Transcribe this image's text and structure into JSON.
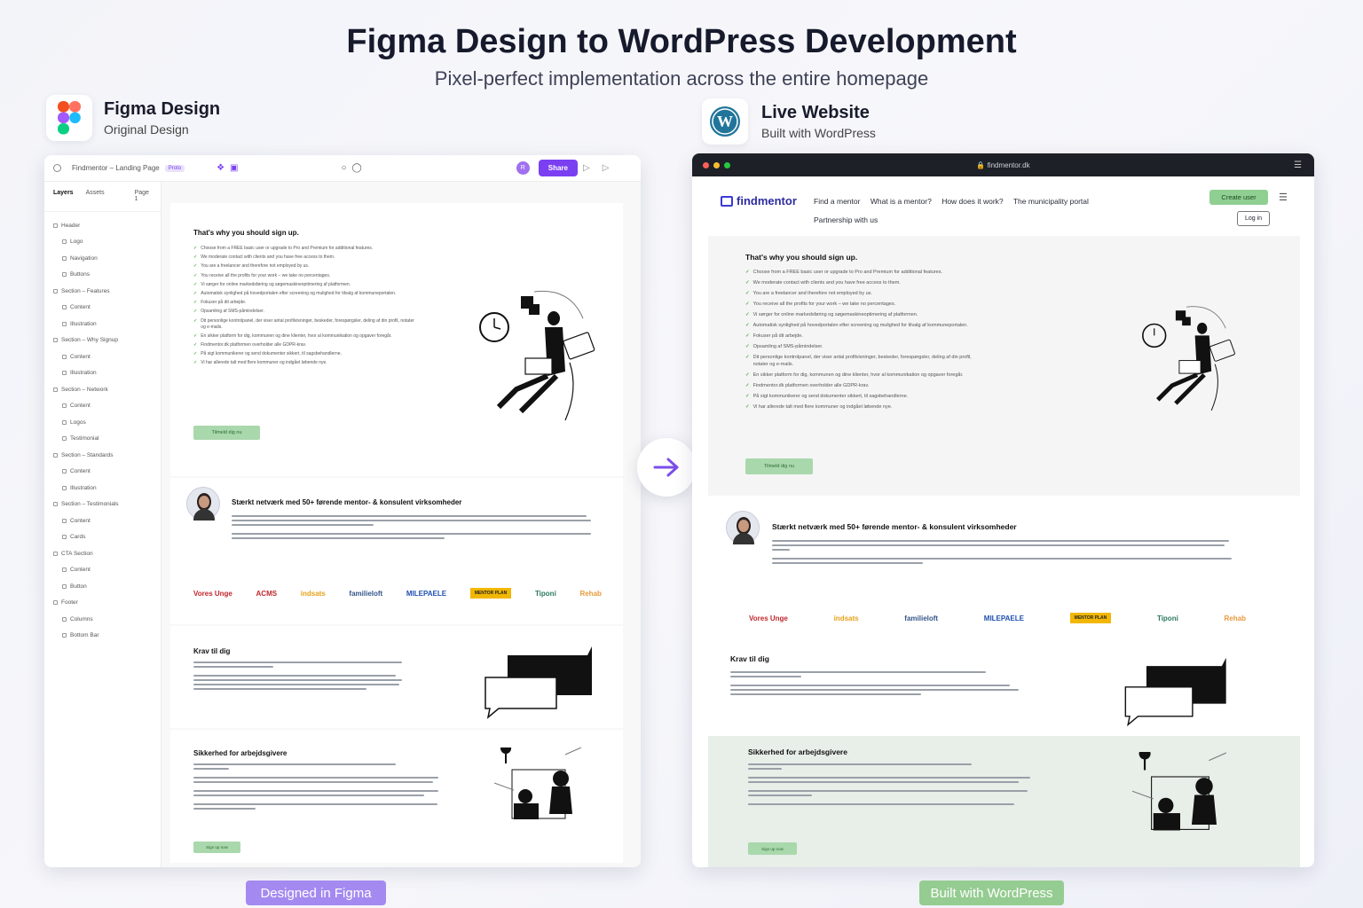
{
  "header": {
    "title": "Figma Design to WordPress Development",
    "subtitle": "Pixel-perfect implementation across the entire homepage"
  },
  "left_header": {
    "title": "Figma Design",
    "subtitle": "Original Design"
  },
  "right_header": {
    "title": "Live Website",
    "subtitle": "Built with WordPress"
  },
  "figma": {
    "file_name": "Findmentor – Landing Page",
    "badge": "Proto",
    "share": "Share",
    "avatar": "R",
    "tabs": [
      "Layers",
      "Assets",
      "Page 1"
    ],
    "layers": [
      "Header",
      "Logo",
      "Navigation",
      "Buttons",
      "Section – Features",
      "Content",
      "Illustration",
      "Section – Why Signup",
      "Content",
      "Illustration",
      "Section – Network",
      "Content",
      "Logos",
      "Testimonial",
      "Section – Standards",
      "Content",
      "Illustration",
      "Section – Testimonials",
      "Content",
      "Cards",
      "CTA Section",
      "Content",
      "Button",
      "Footer",
      "Columns",
      "Bottom Bar"
    ]
  },
  "browser": {
    "url": "findmentor.dk"
  },
  "site": {
    "logo": "findmentor",
    "nav": [
      "Find a mentor",
      "What is a mentor?",
      "How does it work?",
      "The municipality portal",
      "Partnership with us"
    ],
    "create_user": "Create user",
    "login": "Log in"
  },
  "content": {
    "signup_title": "That's why you should sign up.",
    "checks": [
      "Choose from a FREE basic user or upgrade to Pro and Premium for additional features.",
      "We moderate contact with clients and you have free access to them.",
      "You are a freelancer and therefore not employed by us.",
      "You receive all the profits for your work – we take no percentages.",
      "Vi sørger for online markedsføring og søgemaskineoptimering af platformen.",
      "Automatisk synlighed på hovedportalen efter screening og mulighed for tilvalg af kommuneportalen.",
      "Fokuser på dit arbejde.",
      "Opsamling af SMS-påmindelser.",
      "Dit personlige kontrolpanel, der viser antal profilvisninger, beskeder, forespørgsler, deling af din profil, notater og e-mails.",
      "En sikker platform for dig, kommunen og dine klienter, hvor al kommunikation og opgaver foregår.",
      "Findmentor.dk platformen overholder alle GDPR-krav.",
      "På sigt kommunikerer og send dokumenter sikkert, til sagsbehandlerne.",
      "Vi har allerede talt med flere kommuner og indgået løbende nye."
    ],
    "signup_button": "Tilmeld dig nu",
    "network_title": "Stærkt netværk med 50+ førende mentor- & konsulent virksomheder",
    "partner_logos": [
      "Vores Unge",
      "ACMS",
      "indsats",
      "familieloft",
      "MILEPAELE",
      "MENTOR PLAN",
      "Tiponi",
      "Rehab"
    ],
    "krav_title": "Krav til dig",
    "security_title": "Sikkerhed for arbejdsgivere",
    "security_button": "Sign up now"
  },
  "footer_badges": {
    "left": "Designed in Figma",
    "right": "Built with WordPress"
  },
  "colors": {
    "figma_purple": "#7b3ff2",
    "wp_green": "#8fcf92",
    "badge_purple": "#a48af0",
    "badge_green": "#95cc91"
  }
}
